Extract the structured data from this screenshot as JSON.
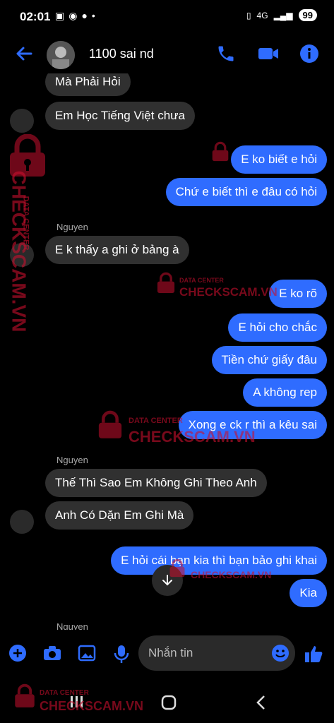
{
  "status": {
    "time": "02:01",
    "network": "4G",
    "battery": "99"
  },
  "header": {
    "contact_name": "1100 sai nd",
    "icons": [
      "back-arrow-icon",
      "phone-icon",
      "video-icon",
      "info-icon"
    ]
  },
  "messages": [
    {
      "side": "in",
      "text": "Mà Phải Hỏi"
    },
    {
      "side": "in",
      "text": "Em Học Tiếng Việt chưa"
    },
    {
      "side": "out",
      "text": "E ko biết e hỏi"
    },
    {
      "side": "out",
      "text": "Chứ e biết thì e đâu có hỏi"
    },
    {
      "side": "sender",
      "text": "Nguyen"
    },
    {
      "side": "in",
      "text": "E k thấy a ghi ở bảng à"
    },
    {
      "side": "out",
      "text": "E ko rõ"
    },
    {
      "side": "out",
      "text": "E hỏi cho chắc"
    },
    {
      "side": "out",
      "text": "Tiền chứ giấy đâu"
    },
    {
      "side": "out",
      "text": "A không rep"
    },
    {
      "side": "out",
      "text": "Xong e ck r thì a kêu sai"
    },
    {
      "side": "sender",
      "text": "Nguyen"
    },
    {
      "side": "in",
      "text": "Thế Thì Sao Em Không Ghi Theo Anh"
    },
    {
      "side": "in",
      "text": "Anh Có Dặn Em Ghi Mà"
    },
    {
      "side": "out",
      "text": "E hỏi cái bạn kia thì bạn bảo ghi khai"
    },
    {
      "side": "out",
      "text": "Kia"
    },
    {
      "side": "sender",
      "text": "Nguyen"
    }
  ],
  "composer": {
    "placeholder": "Nhắn tin",
    "icons": [
      "plus-icon",
      "camera-icon",
      "image-icon",
      "mic-icon",
      "emoji-icon",
      "like-icon"
    ]
  },
  "watermark": {
    "brand": "CHECKSCAM.VN",
    "tagline": "DATA CENTER",
    "color": "#c8102e"
  },
  "colors": {
    "accent": "#2f6cff",
    "incoming": "#303030",
    "background": "#000000"
  }
}
